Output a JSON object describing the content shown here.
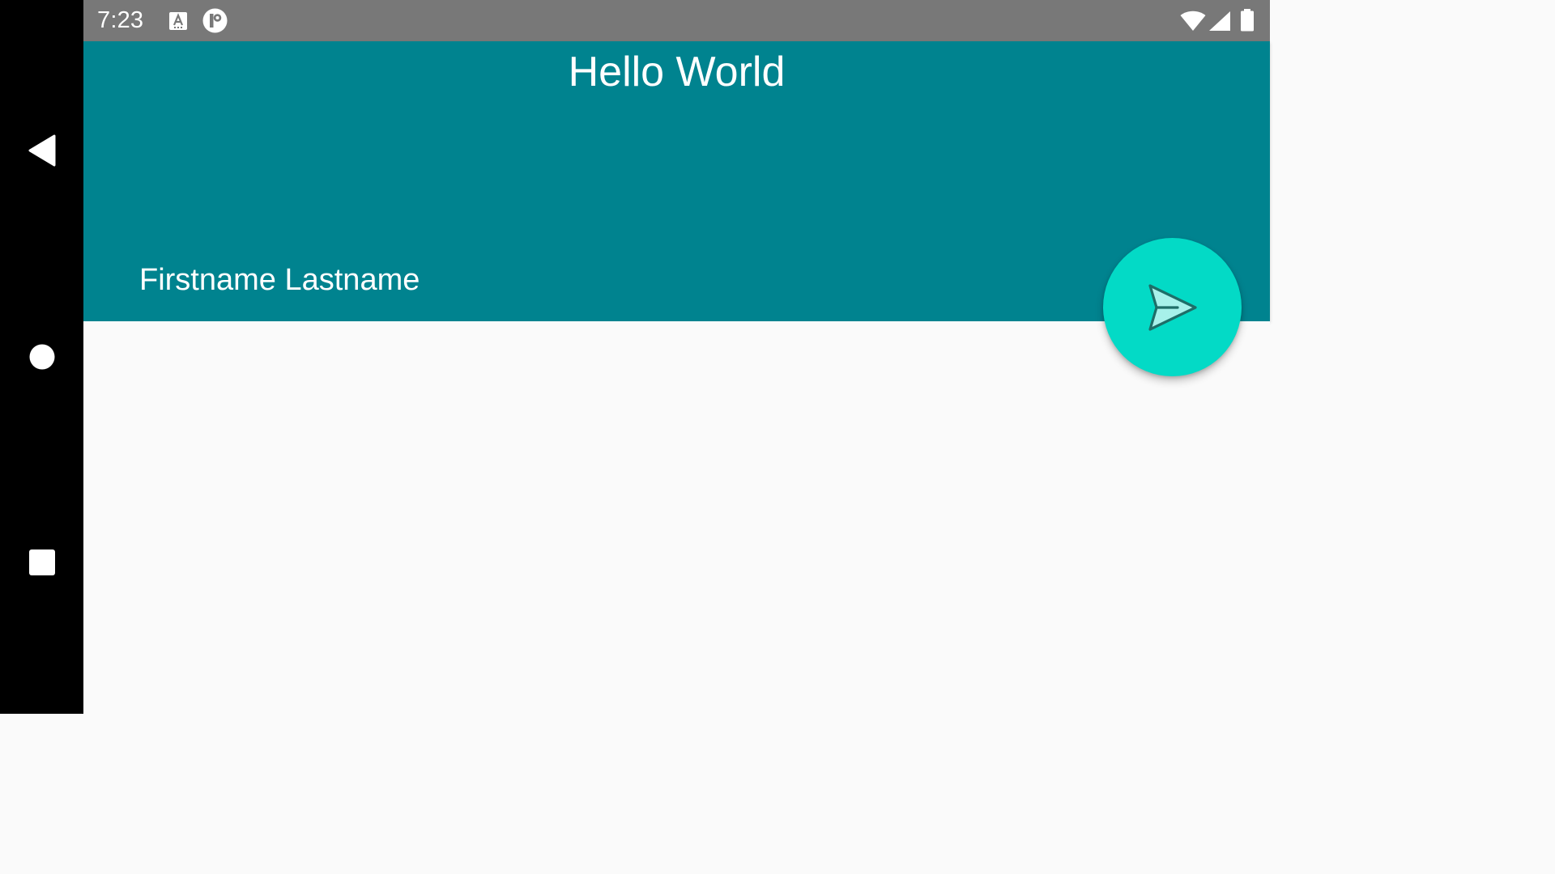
{
  "status_bar": {
    "time": "7:23",
    "notification_icons": [
      "a-keyboard-icon",
      "p-circle-icon"
    ],
    "system_icons": [
      "wifi-icon",
      "cell-signal-icon",
      "battery-icon"
    ]
  },
  "navigation": {
    "buttons": [
      "back",
      "home",
      "recents"
    ]
  },
  "header": {
    "title": "Hello World",
    "name": "Firstname Lastname"
  },
  "fab": {
    "icon": "send-icon"
  },
  "colors": {
    "header_bg": "#00838f",
    "fab_bg": "#03dac6",
    "status_bar_bg": "#787878",
    "nav_bar_bg": "#000000",
    "content_bg": "#fafafa"
  }
}
